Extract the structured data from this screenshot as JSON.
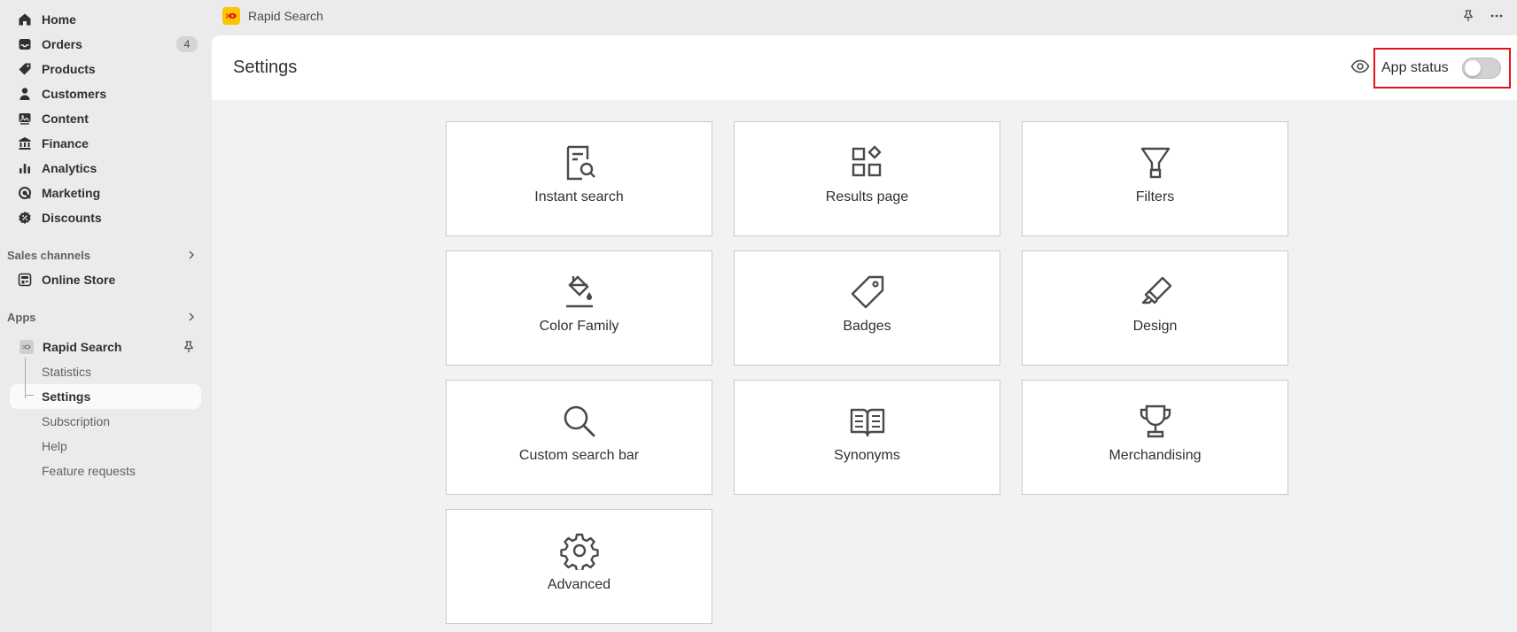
{
  "sidebar": {
    "nav": [
      {
        "label": "Home",
        "icon": "home-icon"
      },
      {
        "label": "Orders",
        "icon": "inbox-icon",
        "badge": "4"
      },
      {
        "label": "Products",
        "icon": "tag-icon"
      },
      {
        "label": "Customers",
        "icon": "person-icon"
      },
      {
        "label": "Content",
        "icon": "image-icon"
      },
      {
        "label": "Finance",
        "icon": "bank-icon"
      },
      {
        "label": "Analytics",
        "icon": "bar-chart-icon"
      },
      {
        "label": "Marketing",
        "icon": "target-icon"
      },
      {
        "label": "Discounts",
        "icon": "discount-icon"
      }
    ],
    "sales_channels": {
      "label": "Sales channels",
      "items": [
        {
          "label": "Online Store",
          "icon": "store-icon"
        }
      ]
    },
    "apps": {
      "label": "Apps",
      "app": {
        "label": "Rapid Search",
        "icon": "rapid-search-logo-icon",
        "pin_icon": "pin-icon"
      },
      "sub_items": [
        "Statistics",
        "Settings",
        "Subscription",
        "Help",
        "Feature requests"
      ],
      "active_sub_item": "Settings"
    }
  },
  "topbar": {
    "app_name": "Rapid Search",
    "icons": [
      "pin-icon",
      "more-horizontal-icon"
    ]
  },
  "page": {
    "title": "Settings",
    "app_status_label": "App status",
    "app_status_enabled": false
  },
  "cards": [
    {
      "label": "Instant search",
      "icon": "search-document-icon"
    },
    {
      "label": "Results page",
      "icon": "layout-blocks-icon"
    },
    {
      "label": "Filters",
      "icon": "filter-funnel-icon"
    },
    {
      "label": "Color Family",
      "icon": "paint-bucket-icon"
    },
    {
      "label": "Badges",
      "icon": "tag-outline-icon"
    },
    {
      "label": "Design",
      "icon": "highlighter-icon"
    },
    {
      "label": "Custom search bar",
      "icon": "magnifier-icon"
    },
    {
      "label": "Synonyms",
      "icon": "open-book-icon"
    },
    {
      "label": "Merchandising",
      "icon": "trophy-icon"
    },
    {
      "label": "Advanced",
      "icon": "gear-icon"
    }
  ],
  "colors": {
    "accent_highlight": "#e5121d",
    "logo_yellow": "#ffc400",
    "sidebar_bg": "#ebebeb",
    "content_bg": "#f1f2f4"
  }
}
